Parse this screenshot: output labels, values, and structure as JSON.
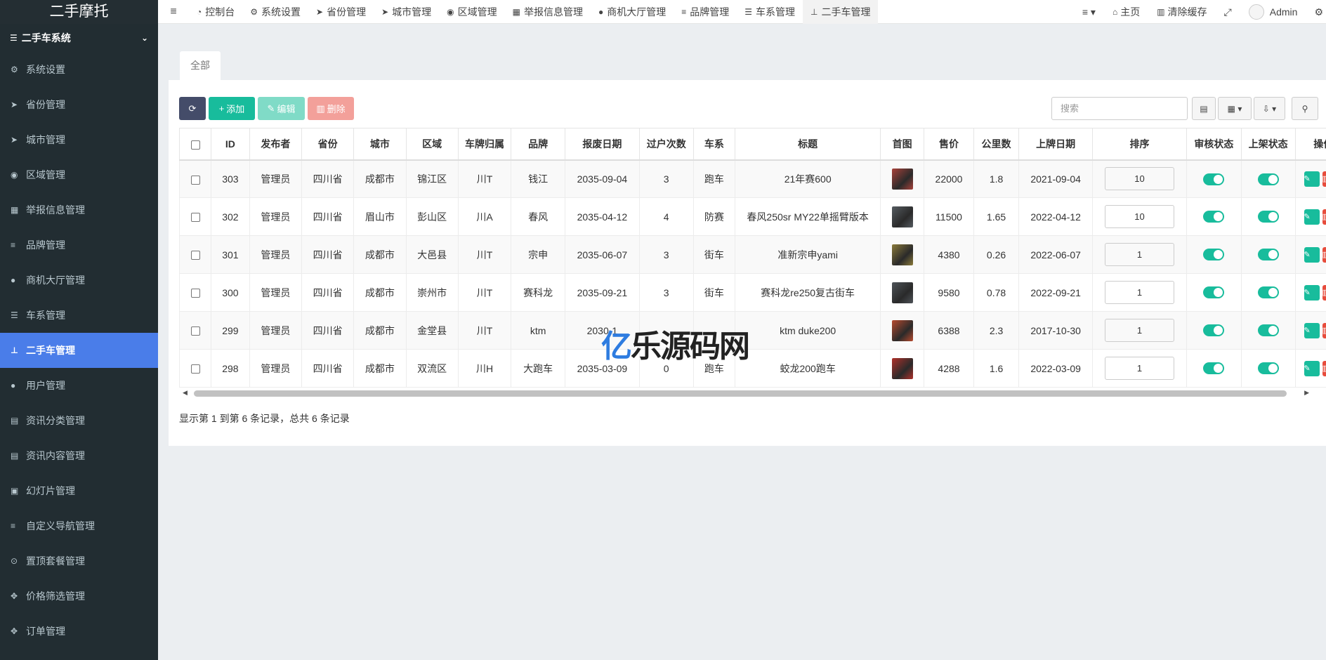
{
  "logo": "二手摩托",
  "sidebar": {
    "group": "二手车系统",
    "items": [
      {
        "label": "系统设置",
        "icon": "gears-icon",
        "glyph": "⚙"
      },
      {
        "label": "省份管理",
        "icon": "location-arrow-icon",
        "glyph": "➤"
      },
      {
        "label": "城市管理",
        "icon": "location-arrow-icon",
        "glyph": "➤"
      },
      {
        "label": "区域管理",
        "icon": "compass-icon",
        "glyph": "◉"
      },
      {
        "label": "举报信息管理",
        "icon": "film-icon",
        "glyph": "▦"
      },
      {
        "label": "品牌管理",
        "icon": "bars-icon",
        "glyph": "≡"
      },
      {
        "label": "商机大厅管理",
        "icon": "user-icon",
        "glyph": "●"
      },
      {
        "label": "车系管理",
        "icon": "server-icon",
        "glyph": "☰"
      },
      {
        "label": "二手车管理",
        "icon": "sitemap-icon",
        "glyph": "⊥",
        "active": true
      },
      {
        "label": "用户管理",
        "icon": "user-icon",
        "glyph": "●"
      },
      {
        "label": "资讯分类管理",
        "icon": "newspaper-icon",
        "glyph": "▤"
      },
      {
        "label": "资讯内容管理",
        "icon": "newspaper-icon",
        "glyph": "▤"
      },
      {
        "label": "幻灯片管理",
        "icon": "image-icon",
        "glyph": "▣"
      },
      {
        "label": "自定义导航管理",
        "icon": "bars-icon",
        "glyph": "≡"
      },
      {
        "label": "置顶套餐管理",
        "icon": "chevron-circle-down-icon",
        "glyph": "⊙"
      },
      {
        "label": "价格筛选管理",
        "icon": "arrows-icon",
        "glyph": "✥"
      },
      {
        "label": "订单管理",
        "icon": "arrows-icon",
        "glyph": "✥"
      }
    ]
  },
  "topnav": {
    "tabs": [
      {
        "label": "控制台",
        "icon": "dashboard-icon",
        "glyph": "◔"
      },
      {
        "label": "系统设置",
        "icon": "gears-icon",
        "glyph": "⚙"
      },
      {
        "label": "省份管理",
        "icon": "location-arrow-icon",
        "glyph": "➤"
      },
      {
        "label": "城市管理",
        "icon": "location-arrow-icon",
        "glyph": "➤"
      },
      {
        "label": "区域管理",
        "icon": "compass-icon",
        "glyph": "◉"
      },
      {
        "label": "举报信息管理",
        "icon": "film-icon",
        "glyph": "▦"
      },
      {
        "label": "商机大厅管理",
        "icon": "user-icon",
        "glyph": "●"
      },
      {
        "label": "品牌管理",
        "icon": "bars-icon",
        "glyph": "≡"
      },
      {
        "label": "车系管理",
        "icon": "server-icon",
        "glyph": "☰"
      },
      {
        "label": "二手车管理",
        "icon": "sitemap-icon",
        "glyph": "⊥",
        "active": true
      }
    ],
    "home": "主页",
    "clear_cache": "清除缓存",
    "user": "Admin"
  },
  "content": {
    "tab_all": "全部",
    "toolbar": {
      "add": "添加",
      "edit": "编辑",
      "delete": "删除"
    },
    "search_placeholder": "搜索",
    "columns": [
      "ID",
      "发布者",
      "省份",
      "城市",
      "区域",
      "车牌归属",
      "品牌",
      "报废日期",
      "过户次数",
      "车系",
      "标题",
      "首图",
      "售价",
      "公里数",
      "上牌日期",
      "排序",
      "审核状态",
      "上架状态",
      "操作"
    ],
    "rows": [
      {
        "id": "303",
        "publisher": "管理员",
        "province": "四川省",
        "city": "成都市",
        "district": "锦江区",
        "plate": "川T",
        "brand": "钱江",
        "scrap_date": "2035-09-04",
        "transfers": "3",
        "series": "跑车",
        "title": "21年赛600",
        "thumb_color": "#a8413a",
        "price": "22000",
        "mileage": "1.8",
        "reg_date": "2021-09-04",
        "sort": "10"
      },
      {
        "id": "302",
        "publisher": "管理员",
        "province": "四川省",
        "city": "眉山市",
        "district": "彭山区",
        "plate": "川A",
        "brand": "春风",
        "scrap_date": "2035-04-12",
        "transfers": "4",
        "series": "防赛",
        "title": "春风250sr MY22单摇臂版本",
        "thumb_color": "#555b60",
        "price": "11500",
        "mileage": "1.65",
        "reg_date": "2022-04-12",
        "sort": "10"
      },
      {
        "id": "301",
        "publisher": "管理员",
        "province": "四川省",
        "city": "成都市",
        "district": "大邑县",
        "plate": "川T",
        "brand": "宗申",
        "scrap_date": "2035-06-07",
        "transfers": "3",
        "series": "街车",
        "title": "准新宗申yami",
        "thumb_color": "#8a7a3a",
        "price": "4380",
        "mileage": "0.26",
        "reg_date": "2022-06-07",
        "sort": "1"
      },
      {
        "id": "300",
        "publisher": "管理员",
        "province": "四川省",
        "city": "成都市",
        "district": "崇州市",
        "plate": "川T",
        "brand": "赛科龙",
        "scrap_date": "2035-09-21",
        "transfers": "3",
        "series": "街车",
        "title": "赛科龙re250复古街车",
        "thumb_color": "#4e5358",
        "price": "9580",
        "mileage": "0.78",
        "reg_date": "2022-09-21",
        "sort": "1"
      },
      {
        "id": "299",
        "publisher": "管理员",
        "province": "四川省",
        "city": "成都市",
        "district": "金堂县",
        "plate": "川T",
        "brand": "ktm",
        "scrap_date": "2030-1",
        "transfers": "",
        "series": "",
        "title": "ktm duke200",
        "thumb_color": "#b84a2e",
        "price": "6388",
        "mileage": "2.3",
        "reg_date": "2017-10-30",
        "sort": "1"
      },
      {
        "id": "298",
        "publisher": "管理员",
        "province": "四川省",
        "city": "成都市",
        "district": "双流区",
        "plate": "川H",
        "brand": "大跑车",
        "scrap_date": "2035-03-09",
        "transfers": "0",
        "series": "跑车",
        "title": "蛟龙200跑车",
        "thumb_color": "#b0302a",
        "price": "4288",
        "mileage": "1.6",
        "reg_date": "2022-03-09",
        "sort": "1"
      }
    ],
    "footer": "显示第 1 到第 6 条记录，总共 6 条记录"
  },
  "watermark": {
    "part1": "亿",
    "part2": "乐",
    "part3": "源码网"
  },
  "colors": {
    "sidebar_bg": "#222d32",
    "active": "#4a7de9",
    "success": "#18bc9c",
    "danger": "#e74c3c"
  }
}
